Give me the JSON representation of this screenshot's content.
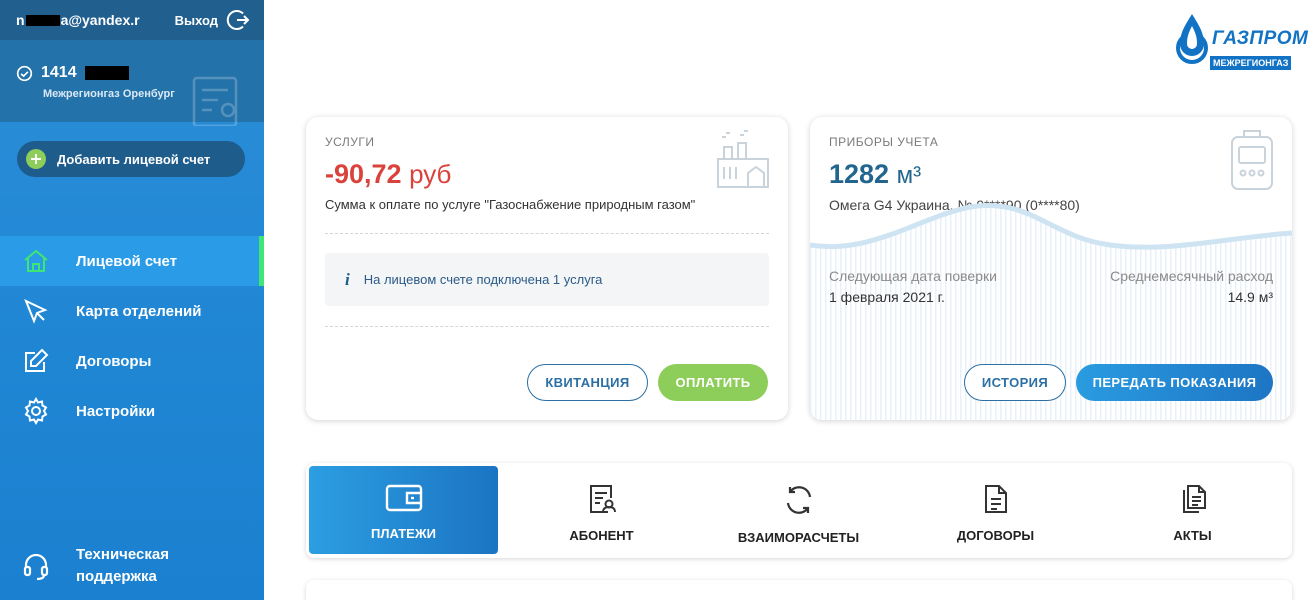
{
  "user": {
    "email_start": "n",
    "email_end": "a@yandex.r",
    "logout_label": "Выход"
  },
  "account": {
    "number": "1414",
    "company": "Межрегионгаз Оренбург"
  },
  "sidebar": {
    "add_account_label": "Добавить лицевой счет",
    "items": [
      {
        "label": "Лицевой счет",
        "icon": "home-icon",
        "active": true
      },
      {
        "label": "Карта отделений",
        "icon": "map-pin-icon",
        "active": false
      },
      {
        "label": "Договоры",
        "icon": "edit-icon",
        "active": false
      },
      {
        "label": "Настройки",
        "icon": "gear-icon",
        "active": false
      }
    ],
    "support_line1": "Техническая",
    "support_line2": "поддержка"
  },
  "logo": {
    "name": "ГАЗПРОМ",
    "sub": "МЕЖРЕГИОНГАЗ"
  },
  "services": {
    "label": "УСЛУГИ",
    "amount": "-90,72",
    "currency": "руб",
    "description": "Сумма к оплате по услуге \"Газоснабжение природным газом\"",
    "info": "На лицевом счете подключена 1 услуга",
    "receipt_button": "КВИТАНЦИЯ",
    "pay_button": "ОПЛАТИТЬ"
  },
  "meters": {
    "label": "ПРИБОРЫ УЧЕТА",
    "value": "1282",
    "unit": "м³",
    "device": "Омега G4 Украина, № 9****90 (0****80)",
    "next_check_label": "Следующая дата поверки",
    "next_check_value": "1 февраля 2021 г.",
    "avg_label": "Среднемесячный расход",
    "avg_value": "14.9 м³",
    "history_button": "ИСТОРИЯ",
    "submit_button": "ПЕРЕДАТЬ ПОКАЗАНИЯ"
  },
  "tabs": [
    {
      "label": "ПЛАТЕЖИ",
      "icon": "wallet-icon",
      "active": true
    },
    {
      "label": "АБОНЕНТ",
      "icon": "subscriber-icon",
      "active": false
    },
    {
      "label": "ВЗАИМОРАСЧЕТЫ",
      "icon": "refresh-icon",
      "active": false
    },
    {
      "label": "ДОГОВОРЫ",
      "icon": "document-icon",
      "active": false
    },
    {
      "label": "АКТЫ",
      "icon": "documents-icon",
      "active": false
    }
  ],
  "colors": {
    "accent": "#1f86d4",
    "negative": "#d9433b",
    "pay": "#8dcd5a",
    "active_marker": "#3ee673"
  }
}
